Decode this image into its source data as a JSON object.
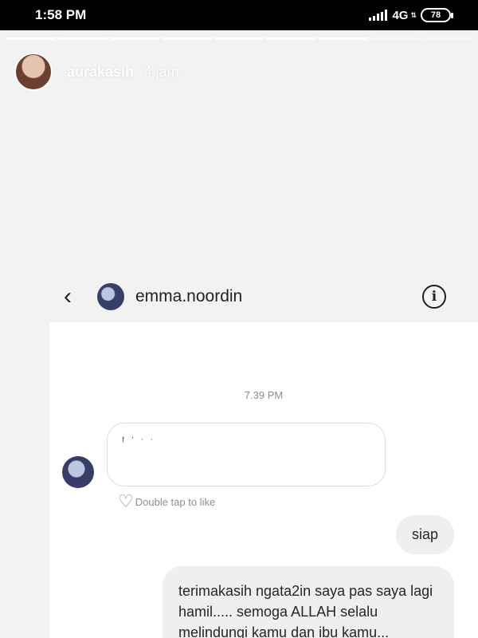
{
  "status_bar": {
    "time": "1:58 PM",
    "network": "4G",
    "battery": "78"
  },
  "story": {
    "username": "aurakasih",
    "time_ago": "4 jam",
    "segments_total": 9,
    "segments_viewed": 7
  },
  "dm": {
    "username": "emma.noordin",
    "timestamp": "7.39 PM",
    "received_message": "ᶠ ˈ   ˑ   ˑ",
    "double_tap_label": "Double tap to like",
    "sent_messages": [
      "siap",
      "terimakasih ngata2in saya pas saya lagi hamil..... semoga ALLAH selalu melindungi kamu dan ibu kamu..."
    ]
  },
  "icons": {
    "back": "chevron-left-icon",
    "info": "info-icon",
    "heart": "heart-outline-icon"
  }
}
